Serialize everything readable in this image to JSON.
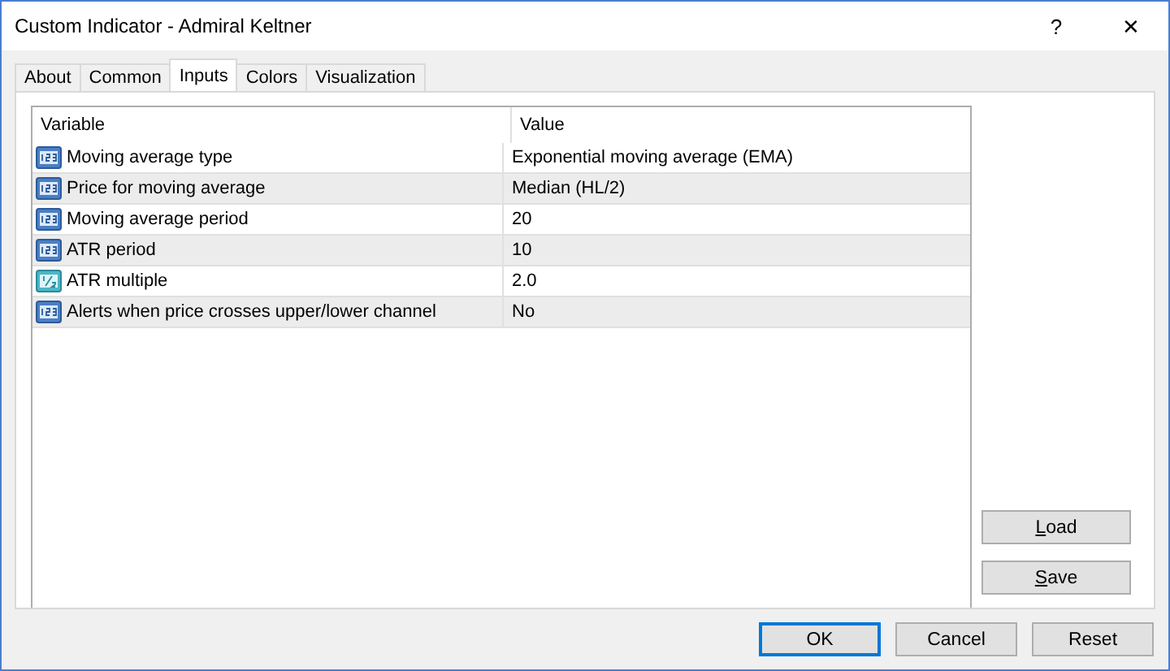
{
  "window": {
    "title": "Custom Indicator - Admiral Keltner",
    "help": "?",
    "close": "✕"
  },
  "tabs": [
    {
      "label": "About",
      "selected": false
    },
    {
      "label": "Common",
      "selected": false
    },
    {
      "label": "Inputs",
      "selected": true
    },
    {
      "label": "Colors",
      "selected": false
    },
    {
      "label": "Visualization",
      "selected": false
    }
  ],
  "table": {
    "columns": [
      "Variable",
      "Value"
    ],
    "rows": [
      {
        "kind": "integer",
        "variable": "Moving average type",
        "value": "Exponential moving average (EMA)"
      },
      {
        "kind": "integer",
        "variable": "Price for moving average",
        "value": "Median (HL/2)"
      },
      {
        "kind": "integer",
        "variable": "Moving average period",
        "value": "20"
      },
      {
        "kind": "integer",
        "variable": "ATR period",
        "value": "10"
      },
      {
        "kind": "fraction",
        "variable": "ATR multiple",
        "value": "2.0"
      },
      {
        "kind": "integer",
        "variable": "Alerts when price crosses upper/lower channel",
        "value": "No"
      }
    ]
  },
  "side_buttons": [
    "Load",
    "Save"
  ],
  "buttons": [
    {
      "label": "OK",
      "default": true
    },
    {
      "label": "Cancel",
      "default": false
    },
    {
      "label": "Reset",
      "default": false
    }
  ]
}
